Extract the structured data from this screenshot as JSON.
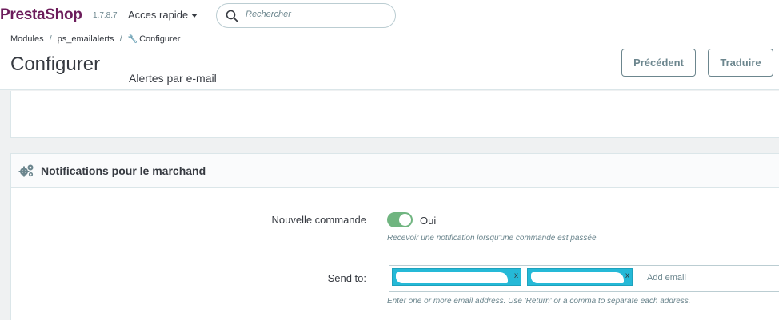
{
  "header": {
    "logo_part1": "Presta",
    "logo_part2": "Shop",
    "version": "1.7.8.7",
    "quick_access": "Acces rapide",
    "search_placeholder": "Rechercher"
  },
  "breadcrumb": {
    "item1": "Modules",
    "item2": "ps_emailalerts",
    "item3": "Configurer"
  },
  "page": {
    "title": "Configurer",
    "subtitle": "Alertes par e-mail",
    "btn_previous": "Précédent",
    "btn_translate": "Traduire"
  },
  "panel": {
    "title": "Notifications pour le marchand",
    "new_order_label": "Nouvelle commande",
    "new_order_value": "Oui",
    "new_order_enabled": true,
    "new_order_help": "Recevoir une notification lorsqu'une commande est passée.",
    "send_to_label": "Send to:",
    "tag_remove": "x",
    "add_email_placeholder": "Add email",
    "send_to_help": "Enter one or more email address. Use 'Return' or a comma to separate each address."
  },
  "colors": {
    "brand_primary": "#25b9d7",
    "logo": "#6c1c5b",
    "toggle_on": "#70b580"
  }
}
